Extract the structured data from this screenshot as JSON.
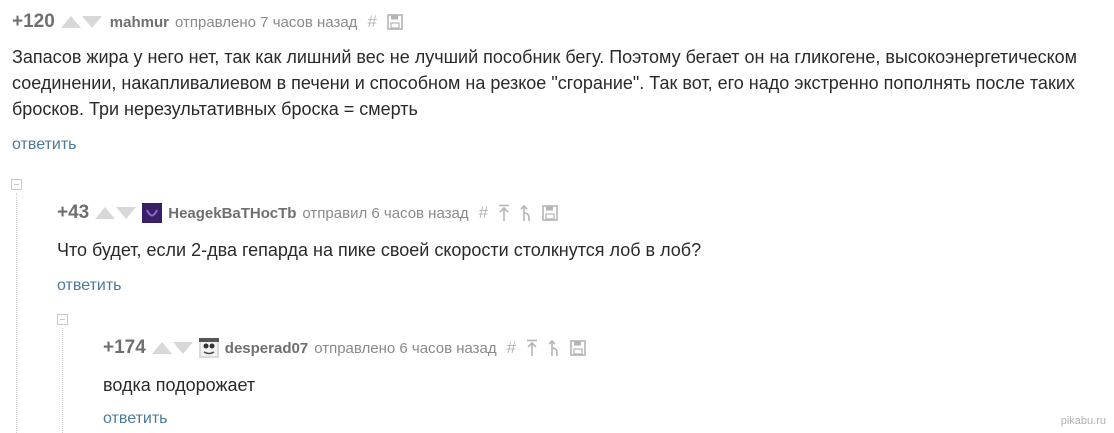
{
  "comments": [
    {
      "rating": "+120",
      "username": "mahmur",
      "meta": "отправлено 7 часов назад",
      "text": "Запасов жира у него нет, так как лишний вес не лучший пособник бегу. Поэтому бегает он на гликогене, высокоэнергетическом соединении, накапливалиевом в печени и способном на резкое \"сгорание\". Так вот, его надо экстренно пополнять после таких бросков. Три нерезультативных броска = смерть",
      "reply_label": "ответить"
    },
    {
      "rating": "+43",
      "username": "НеаgekВаТНосТb",
      "meta": "отправил 6 часов назад",
      "text": "Что будет, если 2-два гепарда на пике своей скорости столкнутся лоб в лоб?",
      "reply_label": "ответить"
    },
    {
      "rating": "+174",
      "username": "desperad07",
      "meta": "отправлено 6 часов назад",
      "text": "водка подорожает",
      "reply_label": "ответить"
    }
  ],
  "icons": {
    "hash": "#",
    "vote_up": "arrow-up-icon",
    "vote_down": "arrow-down-icon",
    "save": "floppy-disk-icon",
    "to_top": "arrow-up-to-bar-icon",
    "to_parent": "branch-icon",
    "collapse": "minus-square-icon"
  },
  "watermark": "pikabu.ru",
  "colors": {
    "rating": "#6f6f6f",
    "link": "#4c7a9c",
    "meta": "#8a8a8a",
    "icon": "#b5b5b5"
  }
}
